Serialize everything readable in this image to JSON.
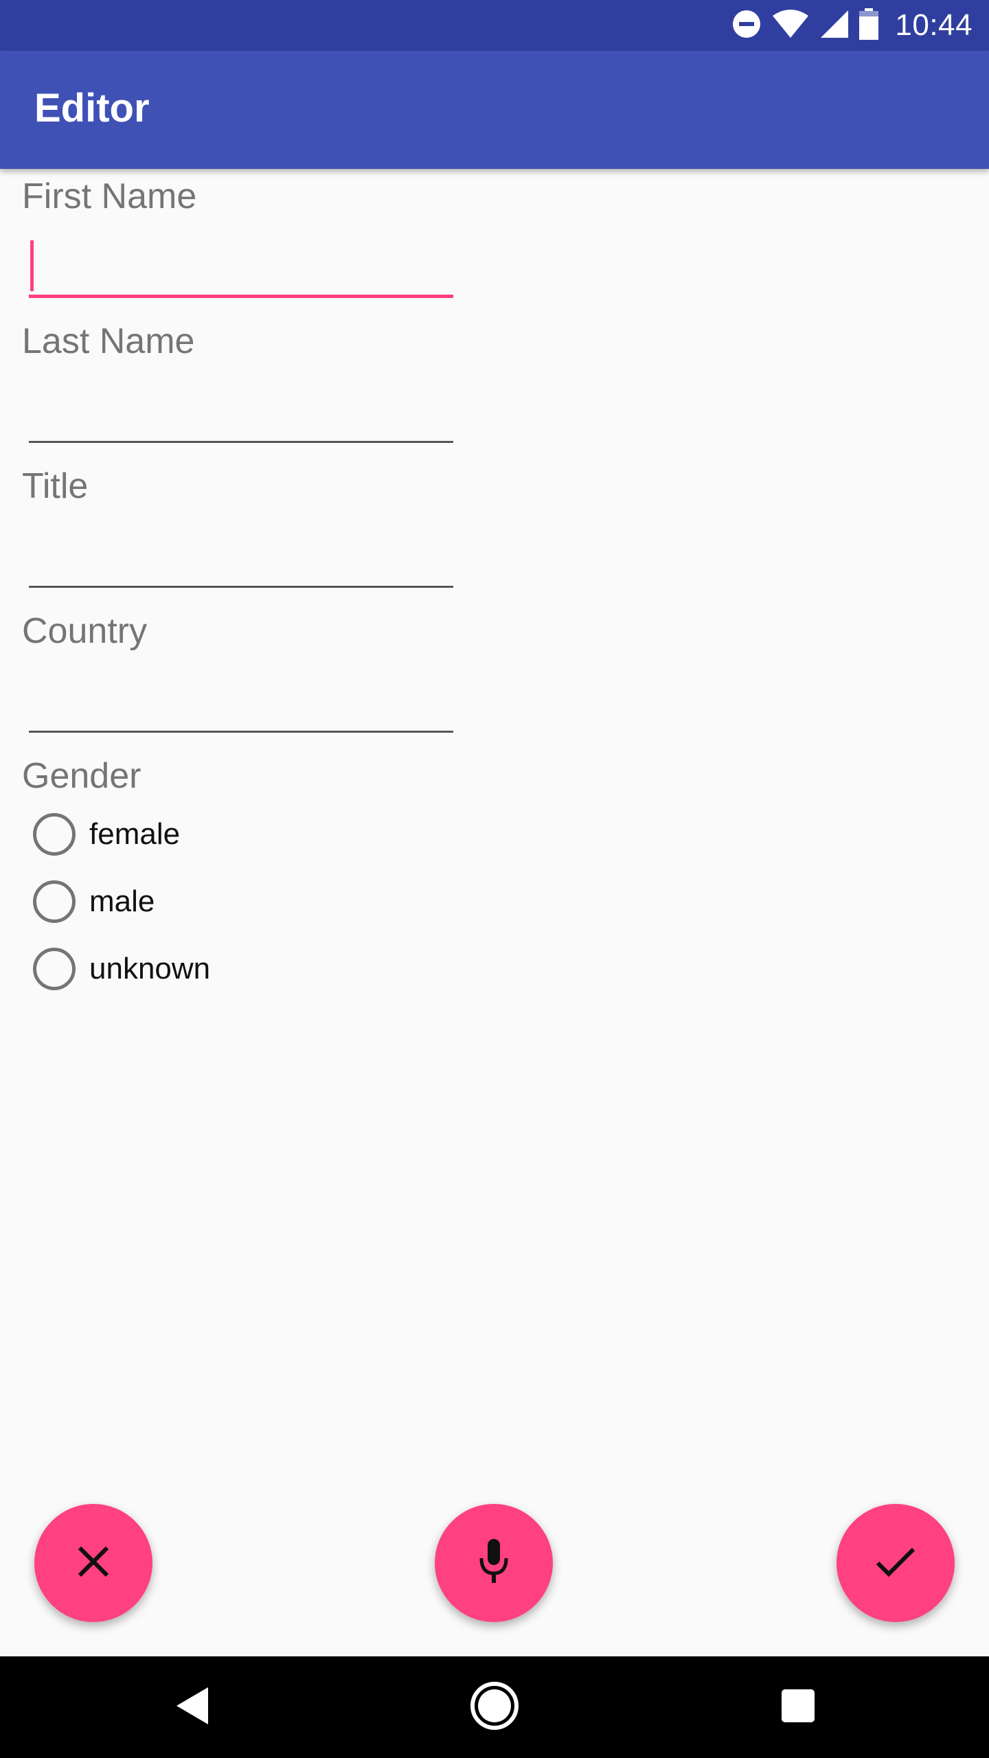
{
  "status_bar": {
    "time": "10:44",
    "icons": [
      "do-not-disturb-icon",
      "wifi-icon",
      "cell-signal-icon",
      "battery-icon"
    ]
  },
  "app_bar": {
    "title": "Editor"
  },
  "form": {
    "first_name": {
      "label": "First Name",
      "value": ""
    },
    "last_name": {
      "label": "Last Name",
      "value": ""
    },
    "title": {
      "label": "Title",
      "value": ""
    },
    "country": {
      "label": "Country",
      "value": ""
    },
    "gender": {
      "label": "Gender",
      "options": [
        "female",
        "male",
        "unknown"
      ],
      "selected": null
    }
  },
  "actions": {
    "cancel_icon": "close-icon",
    "voice_icon": "microphone-icon",
    "confirm_icon": "check-icon"
  },
  "nav_bar": {
    "icons": [
      "back-icon",
      "home-icon",
      "recents-icon"
    ]
  },
  "colors": {
    "status_bar": "#303f9f",
    "primary": "#3f51b5",
    "accent": "#ff4081",
    "background": "#fafafa"
  }
}
